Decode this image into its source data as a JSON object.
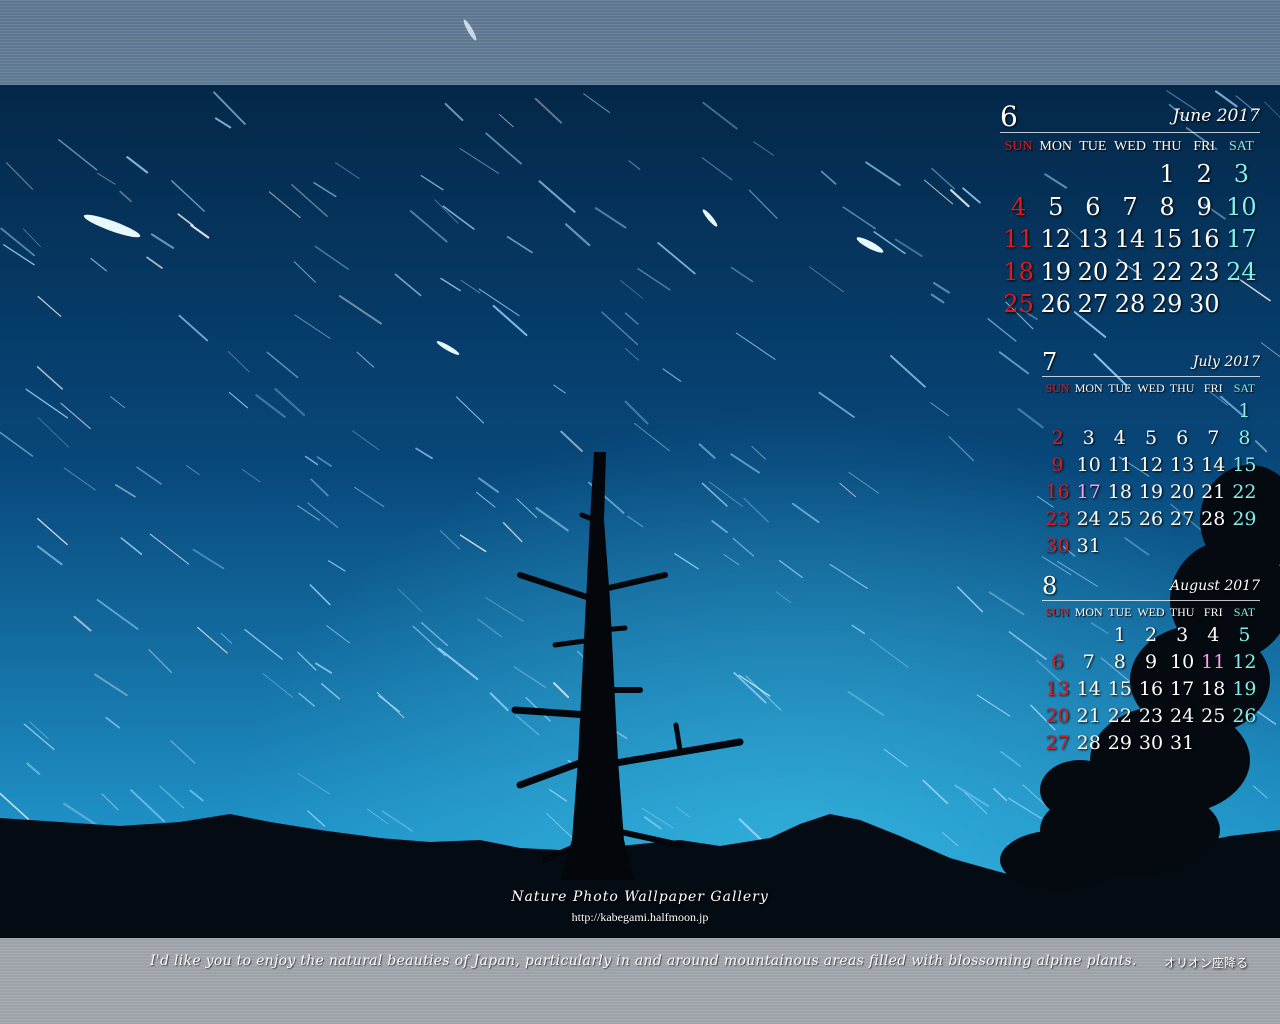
{
  "calendars": {
    "june": {
      "month_number": "6",
      "month_name": "June 2017",
      "weekdays": [
        "SUN",
        "MON",
        "TUE",
        "WED",
        "THU",
        "FRI",
        "SAT"
      ],
      "weeks": [
        [
          "",
          "",
          "",
          "",
          "1",
          "2",
          "3"
        ],
        [
          "4",
          "5",
          "6",
          "7",
          "8",
          "9",
          "10"
        ],
        [
          "11",
          "12",
          "13",
          "14",
          "15",
          "16",
          "17"
        ],
        [
          "18",
          "19",
          "20",
          "21",
          "22",
          "23",
          "24"
        ],
        [
          "25",
          "26",
          "27",
          "28",
          "29",
          "30",
          ""
        ]
      ],
      "holidays": []
    },
    "july": {
      "month_number": "7",
      "month_name": "July 2017",
      "weekdays": [
        "SUN",
        "MON",
        "TUE",
        "WED",
        "THU",
        "FRI",
        "SAT"
      ],
      "weeks": [
        [
          "",
          "",
          "",
          "",
          "",
          "",
          "1"
        ],
        [
          "2",
          "3",
          "4",
          "5",
          "6",
          "7",
          "8"
        ],
        [
          "9",
          "10",
          "11",
          "12",
          "13",
          "14",
          "15"
        ],
        [
          "16",
          "17",
          "18",
          "19",
          "20",
          "21",
          "22"
        ],
        [
          "23",
          "24",
          "25",
          "26",
          "27",
          "28",
          "29"
        ],
        [
          "30",
          "31",
          "",
          "",
          "",
          "",
          ""
        ]
      ],
      "holidays": [
        "17"
      ]
    },
    "august": {
      "month_number": "8",
      "month_name": "August 2017",
      "weekdays": [
        "SUN",
        "MON",
        "TUE",
        "WED",
        "THU",
        "FRI",
        "SAT"
      ],
      "weeks": [
        [
          "",
          "",
          "1",
          "2",
          "3",
          "4",
          "5"
        ],
        [
          "6",
          "7",
          "8",
          "9",
          "10",
          "11",
          "12"
        ],
        [
          "13",
          "14",
          "15",
          "16",
          "17",
          "18",
          "19"
        ],
        [
          "20",
          "21",
          "22",
          "23",
          "24",
          "25",
          "26"
        ],
        [
          "27",
          "28",
          "29",
          "30",
          "31",
          "",
          ""
        ]
      ],
      "holidays": [
        "11"
      ]
    }
  },
  "gallery": {
    "title": "Nature Photo Wallpaper Gallery",
    "url": "http://kabegami.halfmoon.jp"
  },
  "tagline": "I'd like you to enjoy the natural beauties of Japan, particularly in and around mountainous areas filled with blossoming alpine plants.",
  "photo_title": "オリオン座降る",
  "colors": {
    "sunday": "#e0191e",
    "saturday": "#7ff0ee",
    "holiday": "#f4a0f0",
    "sky_top": "#04213f",
    "sky_horizon": "#2aa8d8"
  },
  "icons": [
    "dead-tree-silhouette",
    "mountain-silhouette",
    "star-trails"
  ]
}
